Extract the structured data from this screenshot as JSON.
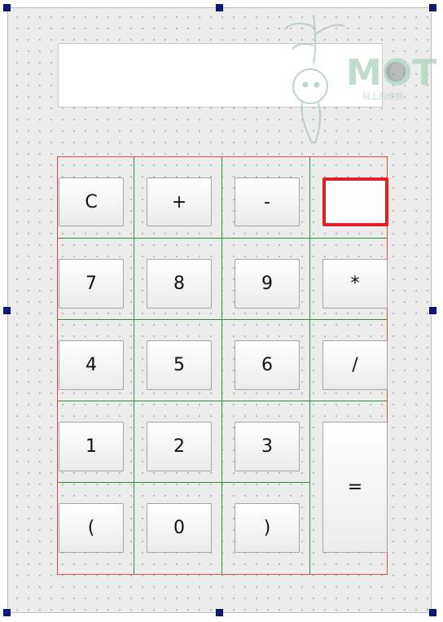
{
  "display": {
    "value": ""
  },
  "watermark": {
    "brand": "MOT",
    "caption": "码上的佳技"
  },
  "buttons": {
    "clear": "C",
    "plus": "+",
    "minus": "-",
    "blank": "",
    "seven": "7",
    "eight": "8",
    "nine": "9",
    "multiply": "*",
    "four": "4",
    "five": "5",
    "six": "6",
    "divide": "/",
    "one": "1",
    "two": "2",
    "three": "3",
    "equals": "=",
    "lparen": "(",
    "zero": "0",
    "rparen": ")"
  },
  "colors": {
    "layout_outline": "#e24a4a",
    "grid_lines": "#2f8f2f",
    "selection": "#e01e25",
    "handles": "#0f1a7a"
  }
}
